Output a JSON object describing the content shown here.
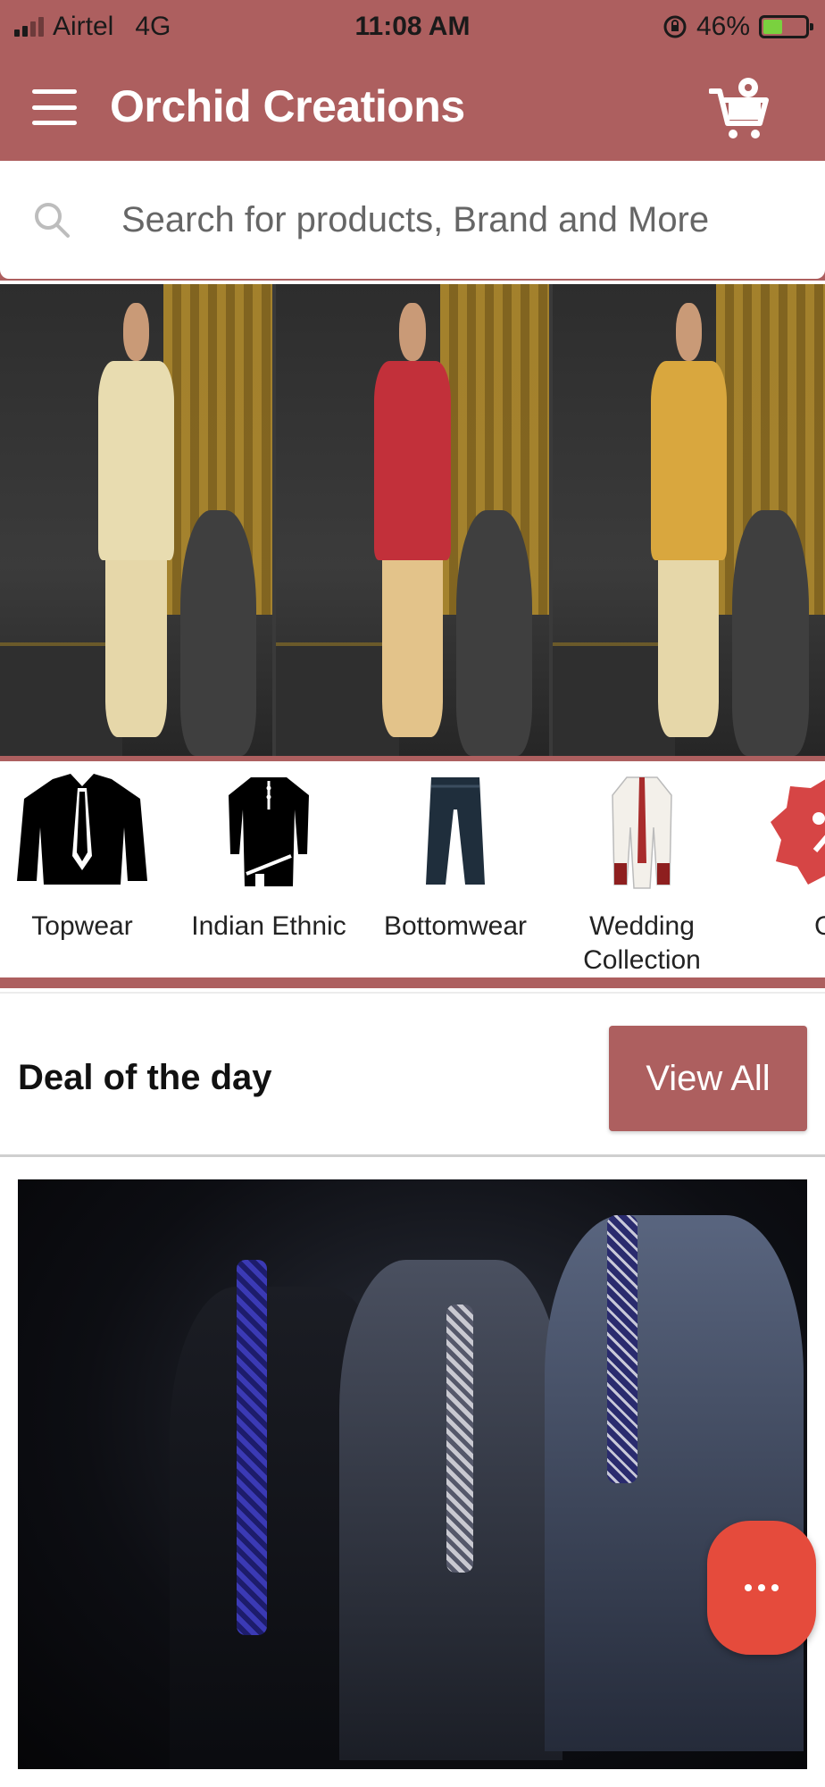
{
  "status_bar": {
    "carrier": "Airtel",
    "network": "4G",
    "time": "11:08 AM",
    "battery_percent": "46%",
    "battery_level": 0.46
  },
  "app_bar": {
    "title": "Orchid Creations",
    "menu_icon": "hamburger-menu-icon",
    "cart_icon": "cart-icon"
  },
  "search": {
    "placeholder": "Search for products, Brand and More",
    "value": ""
  },
  "categories": [
    {
      "label": "Topwear",
      "icon": "topwear-icon"
    },
    {
      "label": "Indian Ethnic",
      "icon": "indian-ethnic-icon"
    },
    {
      "label": "Bottomwear",
      "icon": "bottomwear-icon"
    },
    {
      "label_line1": "Wedding",
      "label_line2": "Collection",
      "icon": "wedding-collection-icon"
    },
    {
      "label": "Of",
      "icon": "offer-icon"
    }
  ],
  "deal": {
    "title": "Deal of the day",
    "view_all_label": "View All"
  },
  "colors": {
    "brand": "#ad5f5f",
    "fab": "#e54b3c"
  }
}
